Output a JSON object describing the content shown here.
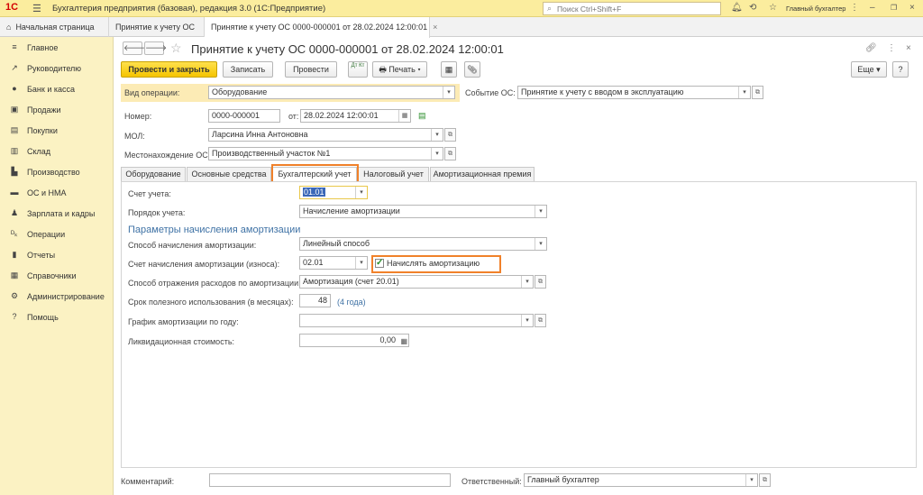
{
  "app": {
    "logo": "1С",
    "title": "Бухгалтерия предприятия (базовая), редакция 3.0  (1С:Предприятие)",
    "search_placeholder": "Поиск Ctrl+Shift+F",
    "user": "Главный бухгалтер"
  },
  "tabs": [
    {
      "label": "Начальная страница"
    },
    {
      "label": "Принятие к учету ОС"
    },
    {
      "label": "Принятие к учету ОС 0000-000001 от 28.02.2024 12:00:01",
      "close": "×"
    }
  ],
  "sidebar": {
    "items": [
      {
        "label": "Главное",
        "icon": "≡"
      },
      {
        "label": "Руководителю",
        "icon": "↗"
      },
      {
        "label": "Банк и касса",
        "icon": "●"
      },
      {
        "label": "Продажи",
        "icon": "▣"
      },
      {
        "label": "Покупки",
        "icon": "▤"
      },
      {
        "label": "Склад",
        "icon": "▥"
      },
      {
        "label": "Производство",
        "icon": "▙"
      },
      {
        "label": "ОС и НМА",
        "icon": "▬"
      },
      {
        "label": "Зарплата и кадры",
        "icon": "♟"
      },
      {
        "label": "Операции",
        "icon": "ᴰₖ"
      },
      {
        "label": "Отчеты",
        "icon": "▮"
      },
      {
        "label": "Справочники",
        "icon": "▦"
      },
      {
        "label": "Администрирование",
        "icon": "⚙"
      },
      {
        "label": "Помощь",
        "icon": "?"
      }
    ]
  },
  "doc": {
    "title": "Принятие к учету ОС 0000-000001 от 28.02.2024 12:00:01"
  },
  "toolbar": {
    "post_close": "Провести и закрыть",
    "save": "Записать",
    "post": "Провести",
    "dt_kt": "Дт Кт",
    "print": "Печать",
    "more": "Еще",
    "help": "?"
  },
  "form": {
    "op_type_label": "Вид операции:",
    "op_type_value": "Оборудование",
    "event_label": "Событие ОС:",
    "event_value": "Принятие к учету с вводом в эксплуатацию",
    "number_label": "Номер:",
    "number_value": "0000-000001",
    "date_label": "от:",
    "date_value": "28.02.2024 12:00:01",
    "mol_label": "МОЛ:",
    "mol_value": "Ларсина Инна Антоновна",
    "location_label": "Местонахождение ОС:",
    "location_value": "Производственный участок №1"
  },
  "form_tabs": [
    "Оборудование",
    "Основные средства",
    "Бухгалтерский учет",
    "Налоговый учет",
    "Амортизационная премия"
  ],
  "accounting": {
    "account_label": "Счет учета:",
    "account_value": "01.01",
    "order_label": "Порядок учета:",
    "order_value": "Начисление амортизации",
    "section_title": "Параметры начисления амортизации",
    "method_label": "Способ начисления амортизации:",
    "method_value": "Линейный способ",
    "depr_account_label": "Счет начисления амортизации (износа):",
    "depr_account_value": "02.01",
    "charge_checkbox_label": "Начислять амортизацию",
    "charge_checked": true,
    "expense_method_label": "Способ отражения расходов по амортизации:",
    "expense_method_value": "Амортизация (счет 20.01)",
    "useful_life_label": "Срок полезного использования (в месяцах):",
    "useful_life_value": "48",
    "useful_life_hint": "(4 года)",
    "schedule_label": "График амортизации по году:",
    "schedule_value": "",
    "liquidation_label": "Ликвидационная стоимость:",
    "liquidation_value": "0,00"
  },
  "footer": {
    "comment_label": "Комментарий:",
    "comment_value": "",
    "responsible_label": "Ответственный:",
    "responsible_value": "Главный бухгалтер"
  },
  "colors": {
    "topbar": "#fbed9e",
    "sidebar": "#fbf2c3",
    "primary_button": "#f5c400",
    "highlight": "#f0812a",
    "section_title": "#3f72a5"
  }
}
